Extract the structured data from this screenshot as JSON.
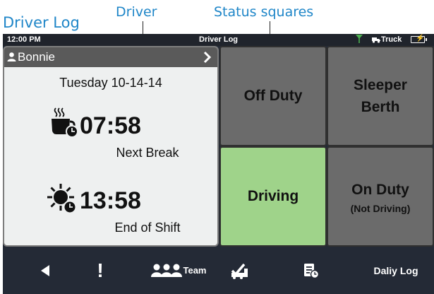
{
  "annotations": {
    "driver_log": "Driver Log",
    "driver": "Driver",
    "status_squares": "Status squares"
  },
  "status_bar": {
    "time": "12:00 PM",
    "title": "Driver Log",
    "vehicle": "Truck",
    "signal_icon": "antenna-icon",
    "battery_icon": "battery-charging-icon"
  },
  "driver": {
    "name": "Bonnie",
    "date": "Tuesday 10-14-14",
    "next_break": {
      "time": "07:58",
      "label": "Next Break",
      "icon": "coffee-clock-icon"
    },
    "end_of_shift": {
      "time": "13:58",
      "label": "End of Shift",
      "icon": "sun-clock-icon"
    }
  },
  "status_tiles": [
    {
      "main": "Off Duty",
      "sub": "",
      "active": false
    },
    {
      "main": "Sleeper Berth",
      "sub": "",
      "active": false
    },
    {
      "main": "Driving",
      "sub": "",
      "active": true
    },
    {
      "main": "On Duty",
      "sub": "(Not Driving)",
      "active": false
    }
  ],
  "colors": {
    "accent_callout": "#1f86c8",
    "active_status": "#9fd38a",
    "inactive_status": "#6b6b6b",
    "nav_background": "#242a36"
  },
  "bottom_nav": {
    "back_icon": "back-arrow-icon",
    "alert_label": "!",
    "team_label": "Team",
    "inspection_icon": "inspection-icon",
    "log_icon": "log-sheet-icon",
    "daily_log_label": "Daliy Log"
  }
}
